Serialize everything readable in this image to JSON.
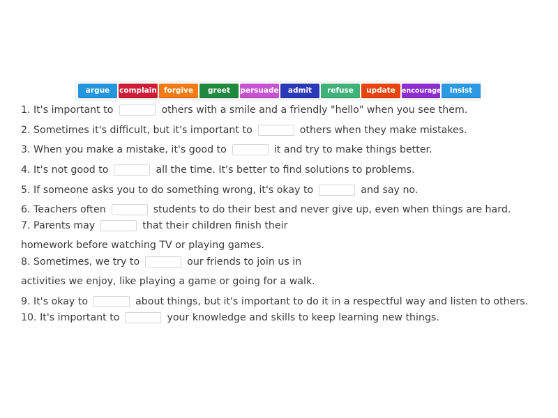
{
  "word_bank": [
    {
      "label": "argue",
      "color": "#2496e0"
    },
    {
      "label": "complain",
      "color": "#cf1d37"
    },
    {
      "label": "forgive",
      "color": "#f47a14"
    },
    {
      "label": "greet",
      "color": "#1f8a3e"
    },
    {
      "label": "persuade",
      "color": "#c753d2"
    },
    {
      "label": "admit",
      "color": "#2a39b8"
    },
    {
      "label": "refuse",
      "color": "#3fb27a"
    },
    {
      "label": "update",
      "color": "#e8450e"
    },
    {
      "label": "encourage",
      "color": "#8e2dd0"
    },
    {
      "label": "insist",
      "color": "#2b9ae4"
    }
  ],
  "sentences": [
    {
      "before": "1. It's important to",
      "after": "others with a smile and a friendly \"hello\" when you see them."
    },
    {
      "before": "2. Sometimes it's difficult, but it's important to",
      "after": "others when they make mistakes."
    },
    {
      "before": "3. When you make a mistake, it's good to",
      "after": "it and try to make things better."
    },
    {
      "before": "4. It's not good to",
      "after": "all the time. It's better to find solutions to problems."
    },
    {
      "before": "5. If someone asks you to do something wrong, it's okay to",
      "after": "and say no."
    },
    {
      "before": "6. Teachers often",
      "after": "students to do their best and never give up, even when things are hard."
    },
    {
      "before": "7. Parents may",
      "after": "that their children finish their",
      "continuation": "homework before watching TV or playing games."
    },
    {
      "before": "8. Sometimes, we try to",
      "after": "our friends to join us in",
      "continuation": "activities we enjoy, like playing a game or going for a walk."
    },
    {
      "before": "9. It's okay to",
      "after": "about things, but it's important to do it in a respectful way and listen to others."
    },
    {
      "before": "10. It's important to",
      "after": "your knowledge and skills to keep learning new things."
    }
  ]
}
